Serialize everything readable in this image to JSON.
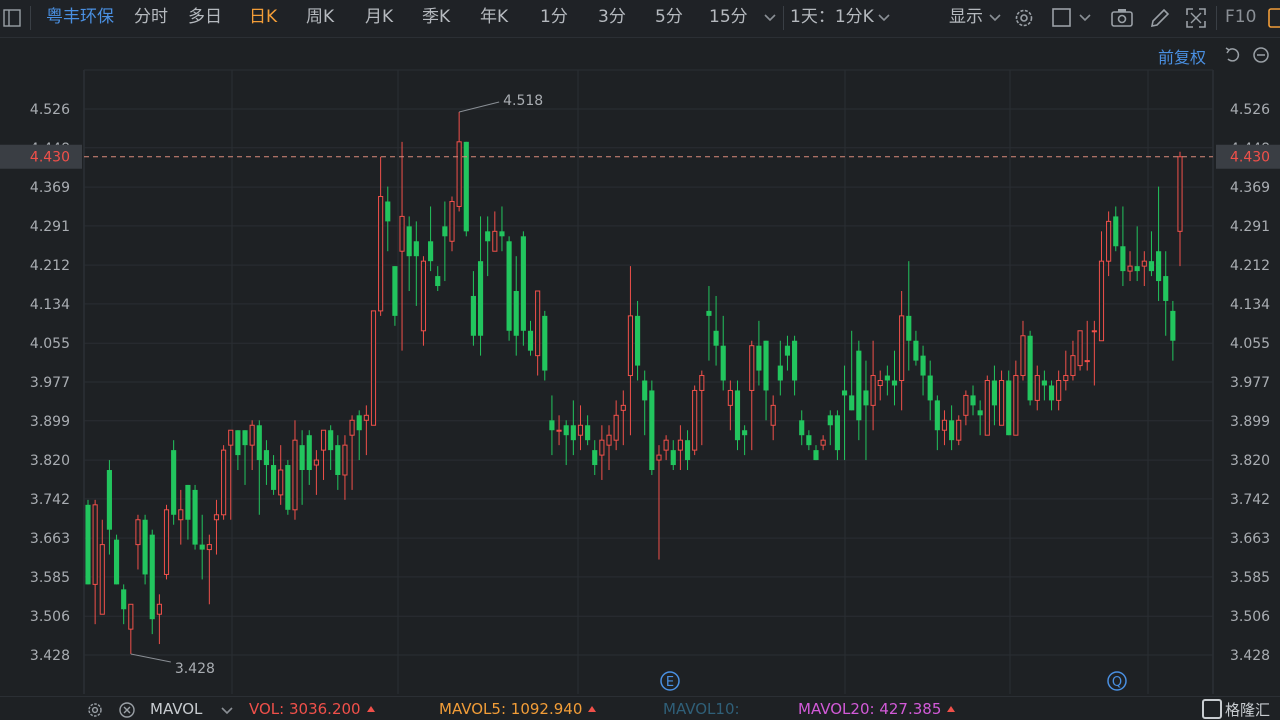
{
  "toolbar": {
    "stock_name": "粤丰环保",
    "tabs": [
      {
        "label": "分时",
        "active": false
      },
      {
        "label": "多日",
        "active": false
      },
      {
        "label": "日K",
        "active": true
      },
      {
        "label": "周K",
        "active": false
      },
      {
        "label": "月K",
        "active": false
      },
      {
        "label": "季K",
        "active": false
      },
      {
        "label": "年K",
        "active": false
      },
      {
        "label": "1分",
        "active": false
      },
      {
        "label": "3分",
        "active": false
      },
      {
        "label": "5分",
        "active": false
      },
      {
        "label": "15分",
        "active": false
      }
    ],
    "interval_select": "1天：1分K",
    "display_label": "显示",
    "f10_label": "F10"
  },
  "adjust_label": "前复权",
  "colors": {
    "up": "#f0504a",
    "down": "#22c55e",
    "accent": "#f29d38",
    "link": "#4a90e2",
    "grid": "#2a2e33"
  },
  "chart_data": {
    "type": "candlestick",
    "y_ticks": [
      "4.526",
      "4.448",
      "4.369",
      "4.291",
      "4.212",
      "4.134",
      "4.055",
      "3.977",
      "3.899",
      "3.820",
      "3.742",
      "3.663",
      "3.585",
      "3.506",
      "3.428"
    ],
    "ylim": [
      3.39,
      4.6
    ],
    "current_price": "4.430",
    "max_label": "4.518",
    "min_label": "3.428",
    "markers": [
      "E",
      "Q"
    ],
    "candles": [
      [
        3.73,
        3.57,
        3.74,
        3.57
      ],
      [
        3.57,
        3.73,
        3.74,
        3.49
      ],
      [
        3.51,
        3.65,
        3.7,
        3.51
      ],
      [
        3.8,
        3.68,
        3.82,
        3.63
      ],
      [
        3.66,
        3.57,
        3.67,
        3.57
      ],
      [
        3.56,
        3.52,
        3.57,
        3.49
      ],
      [
        3.48,
        3.53,
        3.53,
        3.43
      ],
      [
        3.65,
        3.7,
        3.71,
        3.6
      ],
      [
        3.7,
        3.59,
        3.71,
        3.57
      ],
      [
        3.67,
        3.5,
        3.68,
        3.47
      ],
      [
        3.51,
        3.53,
        3.55,
        3.45
      ],
      [
        3.59,
        3.72,
        3.73,
        3.58
      ],
      [
        3.84,
        3.71,
        3.86,
        3.69
      ],
      [
        3.7,
        3.72,
        3.76,
        3.65
      ],
      [
        3.77,
        3.7,
        3.77,
        3.66
      ],
      [
        3.76,
        3.65,
        3.77,
        3.64
      ],
      [
        3.65,
        3.64,
        3.71,
        3.58
      ],
      [
        3.64,
        3.65,
        3.67,
        3.53
      ],
      [
        3.7,
        3.71,
        3.74,
        3.63
      ],
      [
        3.71,
        3.84,
        3.85,
        3.7
      ],
      [
        3.85,
        3.88,
        3.88,
        3.7
      ],
      [
        3.88,
        3.83,
        3.88,
        3.8
      ],
      [
        3.88,
        3.85,
        3.88,
        3.77
      ],
      [
        3.85,
        3.89,
        3.9,
        3.8
      ],
      [
        3.89,
        3.82,
        3.9,
        3.71
      ],
      [
        3.84,
        3.81,
        3.86,
        3.77
      ],
      [
        3.81,
        3.76,
        3.83,
        3.75
      ],
      [
        3.75,
        3.8,
        3.85,
        3.73
      ],
      [
        3.81,
        3.72,
        3.82,
        3.71
      ],
      [
        3.72,
        3.86,
        3.9,
        3.7
      ],
      [
        3.85,
        3.8,
        3.88,
        3.73
      ],
      [
        3.87,
        3.8,
        3.88,
        3.77
      ],
      [
        3.81,
        3.82,
        3.84,
        3.75
      ],
      [
        3.84,
        3.88,
        3.88,
        3.78
      ],
      [
        3.88,
        3.84,
        3.89,
        3.8
      ],
      [
        3.85,
        3.79,
        3.87,
        3.76
      ],
      [
        3.79,
        3.85,
        3.87,
        3.74
      ],
      [
        3.87,
        3.9,
        3.91,
        3.76
      ],
      [
        3.91,
        3.88,
        3.92,
        3.82
      ],
      [
        3.9,
        3.91,
        3.93,
        3.83
      ],
      [
        3.89,
        4.12,
        4.12,
        3.89
      ],
      [
        4.12,
        4.35,
        4.43,
        4.11
      ],
      [
        4.34,
        4.3,
        4.37,
        4.24
      ],
      [
        4.21,
        4.11,
        4.21,
        4.09
      ],
      [
        4.24,
        4.31,
        4.46,
        4.04
      ],
      [
        4.29,
        4.23,
        4.31,
        4.16
      ],
      [
        4.26,
        4.23,
        4.3,
        4.13
      ],
      [
        4.08,
        4.22,
        4.23,
        4.05
      ],
      [
        4.26,
        4.22,
        4.33,
        4.2
      ],
      [
        4.19,
        4.17,
        4.21,
        4.16
      ],
      [
        4.29,
        4.27,
        4.34,
        4.18
      ],
      [
        4.26,
        4.34,
        4.35,
        4.24
      ],
      [
        4.33,
        4.46,
        4.52,
        4.32
      ],
      [
        4.46,
        4.28,
        4.46,
        4.27
      ],
      [
        4.15,
        4.07,
        4.2,
        4.05
      ],
      [
        4.22,
        4.07,
        4.31,
        4.03
      ],
      [
        4.28,
        4.26,
        4.31,
        4.19
      ],
      [
        4.24,
        4.28,
        4.32,
        4.26
      ],
      [
        4.28,
        4.27,
        4.33,
        4.24
      ],
      [
        4.26,
        4.08,
        4.27,
        4.06
      ],
      [
        4.16,
        4.07,
        4.23,
        4.03
      ],
      [
        4.27,
        4.08,
        4.28,
        4.05
      ],
      [
        4.08,
        4.04,
        4.1,
        4.03
      ],
      [
        4.03,
        4.16,
        4.16,
        3.99
      ],
      [
        4.11,
        4.0,
        4.12,
        3.98
      ],
      [
        3.9,
        3.88,
        3.95,
        3.83
      ],
      [
        3.88,
        3.88,
        3.91,
        3.85
      ],
      [
        3.89,
        3.87,
        3.9,
        3.81
      ],
      [
        3.89,
        3.86,
        3.94,
        3.83
      ],
      [
        3.87,
        3.89,
        3.93,
        3.84
      ],
      [
        3.89,
        3.86,
        3.91,
        3.85
      ],
      [
        3.84,
        3.81,
        3.86,
        3.79
      ],
      [
        3.83,
        3.86,
        3.89,
        3.78
      ],
      [
        3.85,
        3.87,
        3.89,
        3.8
      ],
      [
        3.86,
        3.91,
        3.94,
        3.84
      ],
      [
        3.92,
        3.93,
        3.96,
        3.85
      ],
      [
        3.99,
        4.11,
        4.21,
        3.87
      ],
      [
        4.11,
        4.01,
        4.14,
        3.98
      ],
      [
        3.98,
        3.94,
        4.0,
        3.87
      ],
      [
        3.96,
        3.8,
        3.98,
        3.79
      ],
      [
        3.82,
        3.83,
        3.85,
        3.62
      ],
      [
        3.84,
        3.86,
        3.87,
        3.82
      ],
      [
        3.84,
        3.81,
        3.86,
        3.8
      ],
      [
        3.84,
        3.86,
        3.89,
        3.8
      ],
      [
        3.86,
        3.82,
        3.88,
        3.8
      ],
      [
        3.84,
        3.96,
        3.97,
        3.83
      ],
      [
        3.96,
        3.99,
        4.0,
        3.85
      ],
      [
        4.12,
        4.11,
        4.17,
        4.02
      ],
      [
        4.08,
        4.05,
        4.15,
        4.01
      ],
      [
        4.05,
        3.98,
        4.11,
        3.96
      ],
      [
        3.93,
        3.96,
        3.98,
        3.88
      ],
      [
        3.96,
        3.86,
        3.98,
        3.84
      ],
      [
        3.88,
        3.87,
        3.89,
        3.83
      ],
      [
        3.96,
        4.05,
        4.06,
        3.84
      ],
      [
        4.05,
        4.0,
        4.1,
        3.97
      ],
      [
        4.06,
        3.96,
        4.06,
        3.9
      ],
      [
        3.89,
        3.93,
        3.95,
        3.86
      ],
      [
        4.01,
        3.98,
        4.06,
        3.95
      ],
      [
        4.05,
        4.03,
        4.07,
        4.0
      ],
      [
        4.06,
        3.98,
        4.07,
        3.95
      ],
      [
        3.9,
        3.87,
        3.92,
        3.85
      ],
      [
        3.87,
        3.85,
        3.88,
        3.84
      ],
      [
        3.84,
        3.82,
        3.85,
        3.82
      ],
      [
        3.85,
        3.86,
        3.87,
        3.84
      ],
      [
        3.91,
        3.89,
        3.92,
        3.85
      ],
      [
        3.91,
        3.84,
        3.92,
        3.82
      ],
      [
        3.96,
        3.95,
        4.01,
        3.82
      ],
      [
        3.95,
        3.92,
        4.08,
        3.92
      ],
      [
        4.04,
        3.9,
        4.06,
        3.86
      ],
      [
        3.96,
        3.93,
        4.02,
        3.82
      ],
      [
        3.93,
        3.99,
        4.06,
        3.88
      ],
      [
        3.97,
        3.98,
        4.0,
        3.94
      ],
      [
        3.99,
        3.98,
        4.01,
        3.95
      ],
      [
        3.98,
        3.97,
        4.04,
        3.93
      ],
      [
        3.98,
        4.11,
        4.16,
        3.92
      ],
      [
        4.11,
        4.06,
        4.22,
        4.0
      ],
      [
        4.06,
        4.02,
        4.08,
        4.01
      ],
      [
        4.03,
        3.99,
        4.05,
        3.95
      ],
      [
        3.99,
        3.94,
        4.02,
        3.9
      ],
      [
        3.94,
        3.88,
        3.95,
        3.84
      ],
      [
        3.88,
        3.9,
        3.92,
        3.85
      ],
      [
        3.9,
        3.86,
        3.93,
        3.84
      ],
      [
        3.86,
        3.9,
        3.91,
        3.85
      ],
      [
        3.91,
        3.95,
        3.96,
        3.89
      ],
      [
        3.95,
        3.93,
        3.97,
        3.91
      ],
      [
        3.92,
        3.91,
        3.94,
        3.87
      ],
      [
        3.87,
        3.98,
        3.99,
        3.87
      ],
      [
        3.98,
        3.93,
        4.01,
        3.89
      ],
      [
        3.89,
        3.98,
        4.0,
        3.89
      ],
      [
        3.98,
        3.87,
        4.0,
        3.87
      ],
      [
        3.87,
        3.99,
        4.02,
        3.87
      ],
      [
        3.99,
        4.07,
        4.1,
        3.98
      ],
      [
        4.07,
        3.94,
        4.08,
        3.93
      ],
      [
        3.94,
        3.99,
        4.01,
        3.92
      ],
      [
        3.98,
        3.97,
        4.0,
        3.94
      ],
      [
        3.97,
        3.94,
        3.98,
        3.92
      ],
      [
        3.94,
        3.98,
        4.0,
        3.92
      ],
      [
        3.98,
        3.99,
        4.04,
        3.96
      ],
      [
        3.99,
        4.03,
        4.06,
        3.98
      ],
      [
        4.01,
        4.08,
        4.08,
        4.0
      ],
      [
        4.02,
        4.02,
        4.1,
        4.0
      ],
      [
        4.08,
        4.08,
        4.1,
        3.97
      ],
      [
        4.06,
        4.22,
        4.28,
        4.06
      ],
      [
        4.22,
        4.3,
        4.32,
        4.19
      ],
      [
        4.31,
        4.25,
        4.33,
        4.24
      ],
      [
        4.25,
        4.2,
        4.33,
        4.17
      ],
      [
        4.2,
        4.21,
        4.24,
        4.18
      ],
      [
        4.21,
        4.2,
        4.29,
        4.18
      ],
      [
        4.21,
        4.22,
        4.24,
        4.17
      ],
      [
        4.22,
        4.2,
        4.28,
        4.19
      ],
      [
        4.24,
        4.18,
        4.37,
        4.14
      ],
      [
        4.19,
        4.14,
        4.24,
        4.07
      ],
      [
        4.12,
        4.06,
        4.14,
        4.02
      ],
      [
        4.28,
        4.43,
        4.44,
        4.21
      ]
    ],
    "volume_panel": {
      "label": "MAVOL",
      "vol": {
        "name": "VOL:",
        "value": "3036.200"
      },
      "mavol5": {
        "name": "MAVOL5:",
        "value": "1092.940"
      },
      "mavol10": {
        "name": "MAVOL10:",
        "value": ""
      },
      "mavol20": {
        "name": "MAVOL20:",
        "value": "427.385"
      }
    }
  },
  "watermark": "格隆汇"
}
